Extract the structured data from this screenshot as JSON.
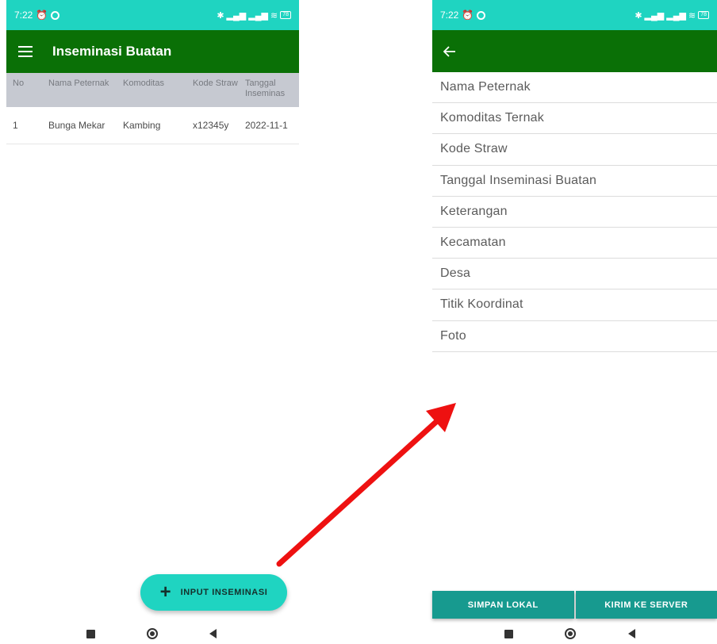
{
  "left_screen": {
    "status": {
      "time": "7:22",
      "battery": "78"
    },
    "appbar": {
      "title": "Inseminasi Buatan",
      "menu_icon": "hamburger-menu-icon"
    },
    "table": {
      "headers": [
        "No",
        "Nama Peternak",
        "Komoditas",
        "Kode Straw",
        "Tanggal Inseminas"
      ],
      "rows": [
        [
          "1",
          "Bunga Mekar",
          "Kambing",
          "x12345y",
          "2022-11-1"
        ]
      ]
    },
    "fab": {
      "label": "INPUT INSEMINASI",
      "icon": "+"
    }
  },
  "right_screen": {
    "status": {
      "time": "7:22",
      "battery": "78"
    },
    "appbar": {
      "back_icon": "←"
    },
    "fields": [
      "Nama Peternak",
      "Komoditas Ternak",
      "Kode Straw",
      "Tanggal Inseminasi Buatan",
      "Keterangan",
      "Kecamatan",
      "Desa",
      "Titik Koordinat",
      "Foto"
    ],
    "buttons": {
      "save_local": "SIMPAN LOKAL",
      "send_server": "KIRIM KE SERVER"
    }
  },
  "colors": {
    "status_bar": "#1fd4c1",
    "app_bar": "#0a7006",
    "fab": "#1fd4c1",
    "bottom_button": "#179a8f",
    "arrow": "#ee1111"
  }
}
